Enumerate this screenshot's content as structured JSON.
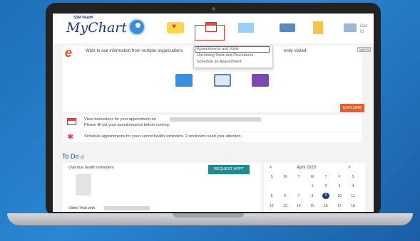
{
  "brand": {
    "org": "SSM Health",
    "name": "MyChart"
  },
  "topbar": {
    "cut_text_1": "Car",
    "cut_text_2": "Id"
  },
  "dropdown": {
    "items": [
      "Appointments and Visits",
      "Upcoming Tests and Procedures",
      "Schedule an Appointment"
    ]
  },
  "banner": {
    "text": "Want to see information from multiple organizations",
    "text_end": "ently visited.",
    "right_tag": "Appoint",
    "explore_label": "EXPLORE"
  },
  "rows": {
    "appt_line1": "View instructions for your appointment on",
    "appt_line2": "Please fill out your questionnaires before coming.",
    "reminder_text": "Schedule appointments for your current health reminders. 2 reminders need your attention."
  },
  "todo": {
    "title": "To Do",
    "overdue_label": "Overdue health reminders",
    "request_label": "REQUEST APPT",
    "video_label": "Video Visit with"
  },
  "calendar": {
    "prev": "<",
    "month": "April 2020",
    "next": ">",
    "weekdays": [
      "S",
      "M",
      "T",
      "W",
      "T",
      "F",
      "S"
    ],
    "week1": [
      "",
      "",
      "",
      "1",
      "2",
      "3",
      "4"
    ],
    "week2": [
      "5",
      "6",
      "7",
      "8",
      "9",
      "10",
      "11"
    ],
    "week3": [
      "12",
      "13",
      "14",
      "15",
      "16",
      "17",
      "18"
    ],
    "today": "9"
  },
  "colors": {
    "accent": "#e06030",
    "teal": "#1f8a8f",
    "navy": "#1b3b6f",
    "highlight": "#dd3333"
  }
}
